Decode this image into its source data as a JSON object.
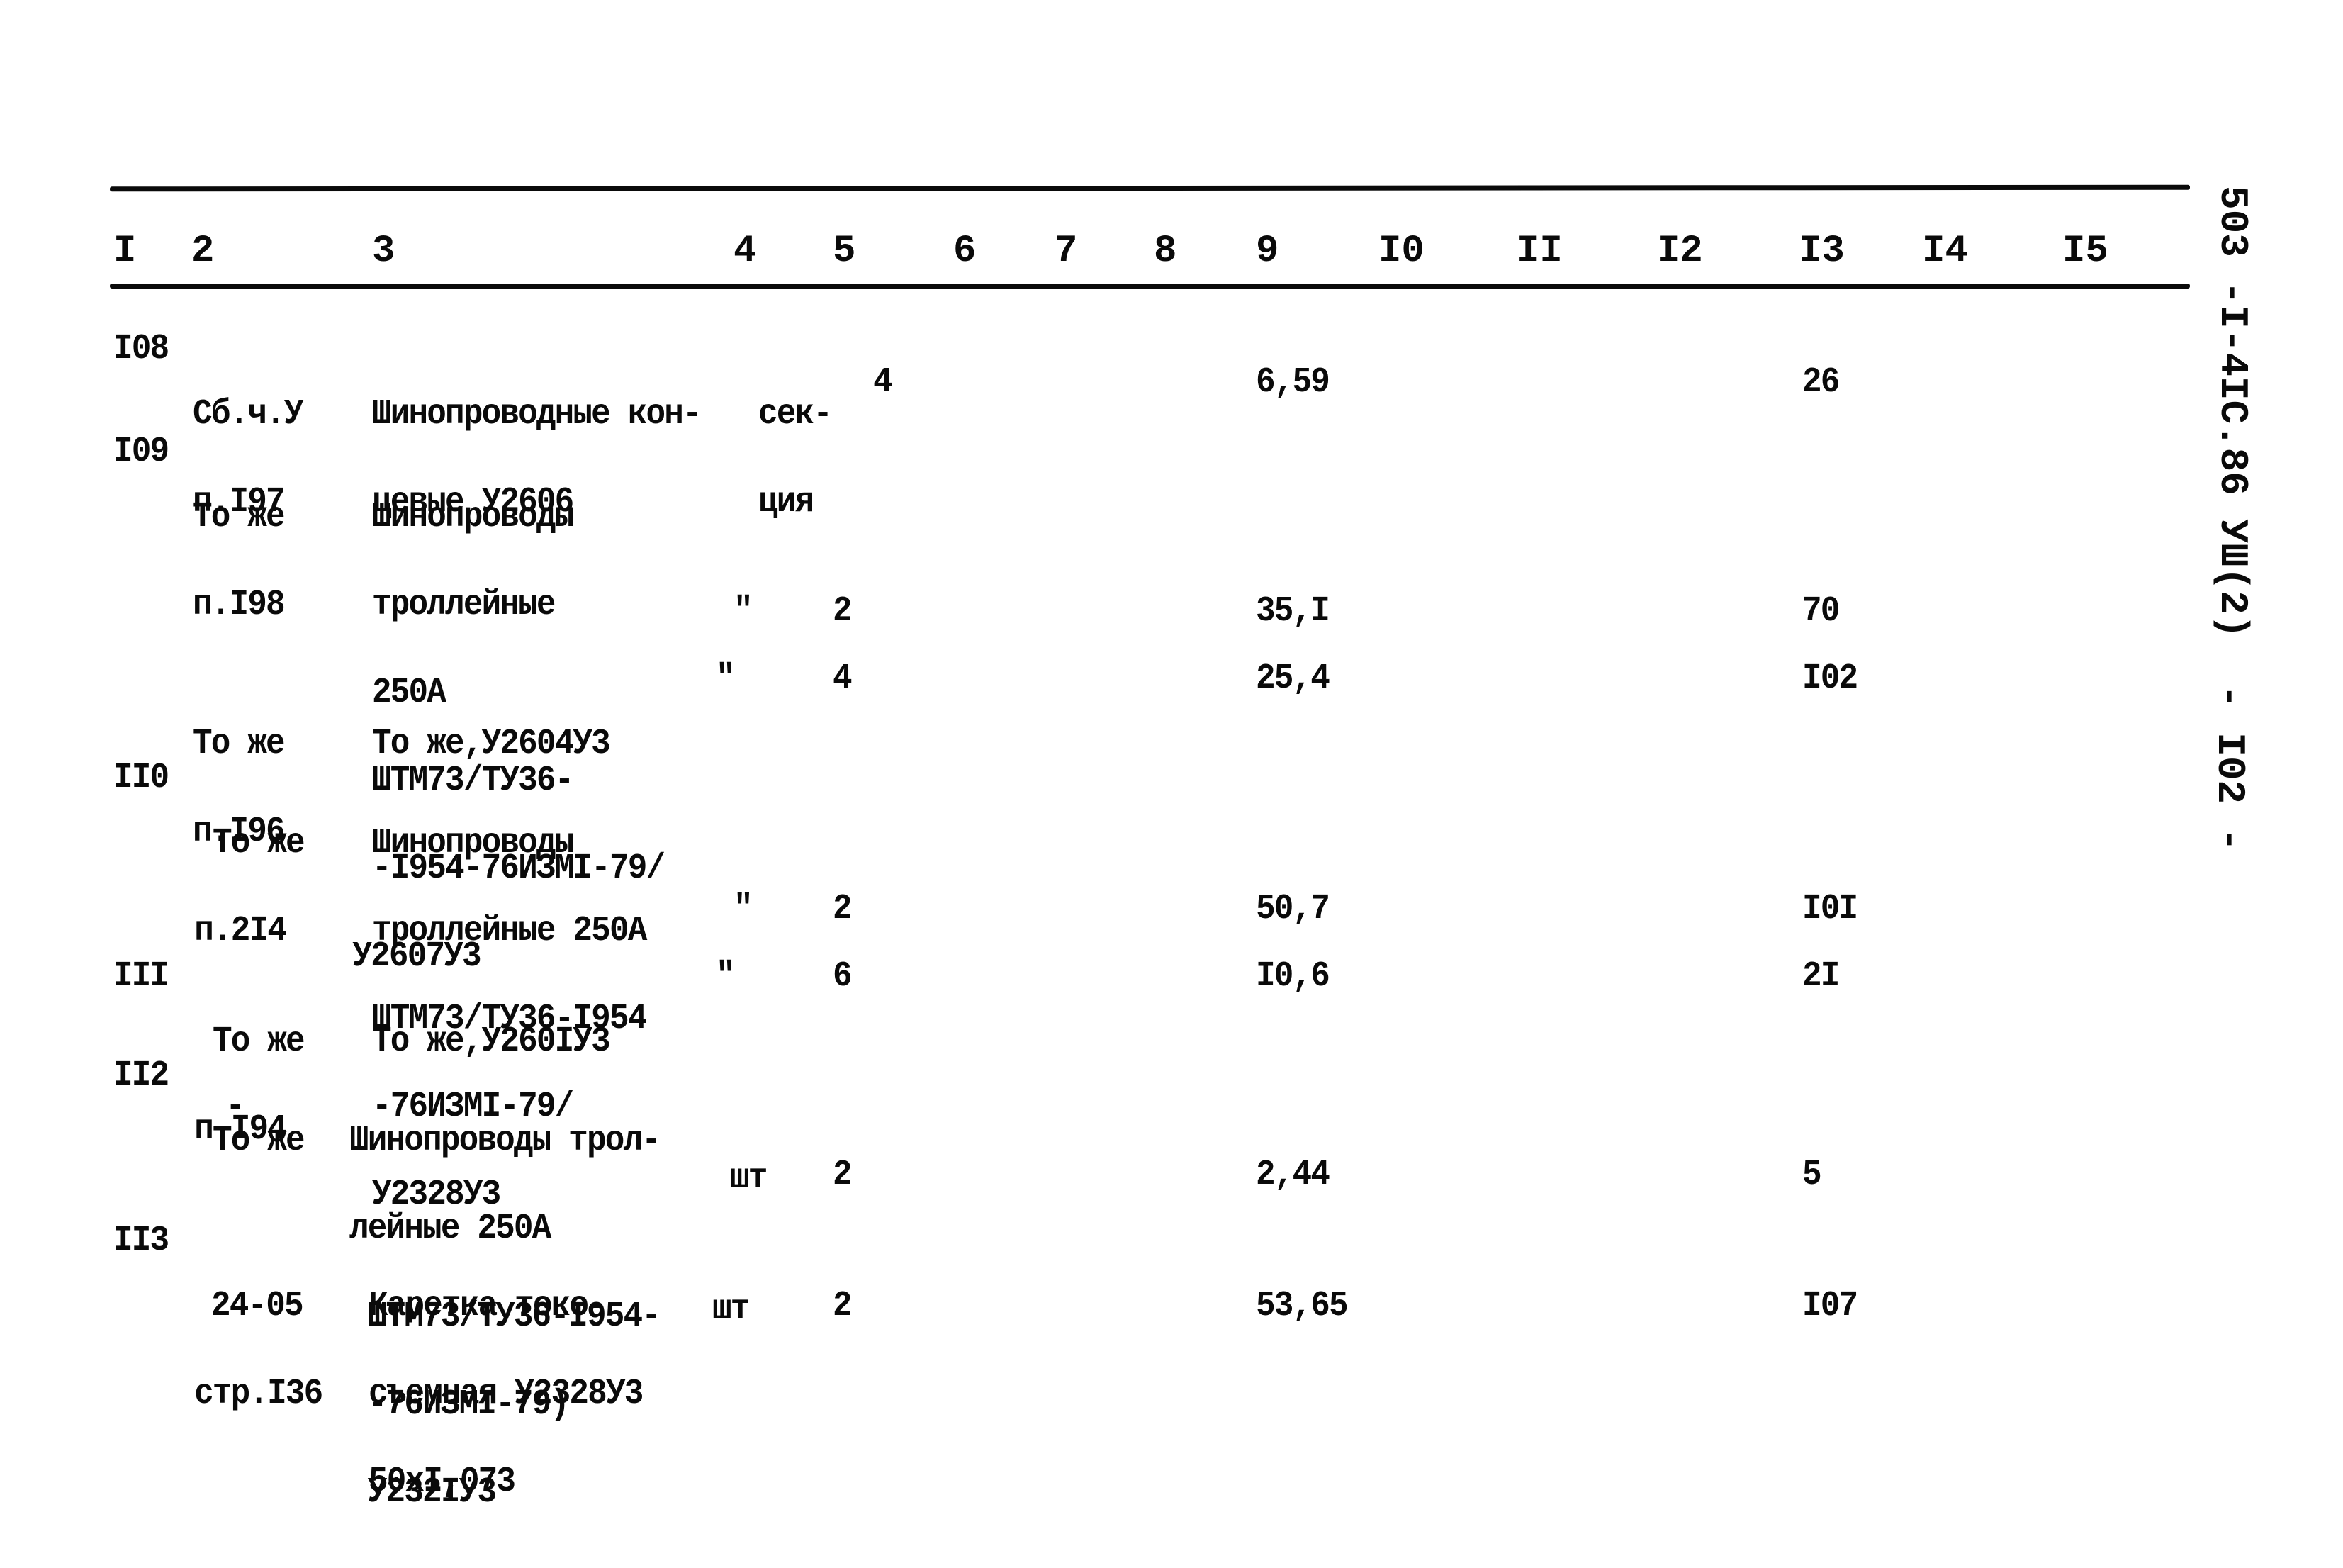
{
  "document": {
    "side_code": "503 -I-4IC.86 УШ(2)",
    "page_number": "- I02 -"
  },
  "table": {
    "columns": [
      "I",
      "2",
      "3",
      "4",
      "5",
      "6",
      "7",
      "8",
      "9",
      "I0",
      "II",
      "I2",
      "I3",
      "I4",
      "I5"
    ],
    "rows": [
      {
        "c1": "I08",
        "c2": [
          "Сб.ч.У",
          "п.I97"
        ],
        "c3": [
          "Шинопроводные кон-",
          "цевые У2606"
        ],
        "c4": [
          "сек-",
          "ция"
        ],
        "c5": "4",
        "c9": "6,59",
        "c13": "26"
      },
      {
        "c1": "I09",
        "c2": [
          "То же",
          "п.I98"
        ],
        "c3": [
          "Шинопроводы",
          "троллейные",
          "250А",
          "ШТМ73/ТУ36-",
          "-I954-76ИЗМI-79/",
          "У2607У3"
        ],
        "c4": "\"",
        "c5": "2",
        "c9": "35,I",
        "c13": "70"
      },
      {
        "c1": "",
        "c2": [
          "То же",
          "п.I96"
        ],
        "c3": [
          "То же,У2604У3"
        ],
        "c4": "\"",
        "c5": "4",
        "c9": "25,4",
        "c13": "I02"
      },
      {
        "c1": "II0",
        "c2": [
          "То же",
          "п.2I4",
          "",
          "-"
        ],
        "c3": [
          "Шинопроводы",
          "троллейные 250А",
          "ШТМ73/ТУ36-I954",
          "-76ИЗМI-79/",
          "У2328У3"
        ],
        "c4": "\"",
        "c5": "2",
        "c9": "50,7",
        "c13": "I0I"
      },
      {
        "c1": "III",
        "c2": [
          "То же",
          "п.I94"
        ],
        "c3": [
          "То же,У260IУ3"
        ],
        "c4": "\"",
        "c5": "6",
        "c9": "I0,6",
        "c13": "2I"
      },
      {
        "c1": "II2",
        "c2": [
          "То же"
        ],
        "c3": [
          "Шинопроводы трол-",
          "лейные 250А",
          " ШТМ73/ТУ36-I954-",
          " -76ИЗМI-79)",
          " У232IУ3"
        ],
        "c4": "шт",
        "c5": "2",
        "c9": "2,44",
        "c13": "5"
      },
      {
        "c1": "II3",
        "c2": [
          "24-05",
          "стр.I36"
        ],
        "c3": [
          "Каретка токо-",
          "съемная У2328У3",
          "50хI,073"
        ],
        "c4": "шт",
        "c5": "2",
        "c9": "53,65",
        "c13": "I07"
      }
    ]
  }
}
